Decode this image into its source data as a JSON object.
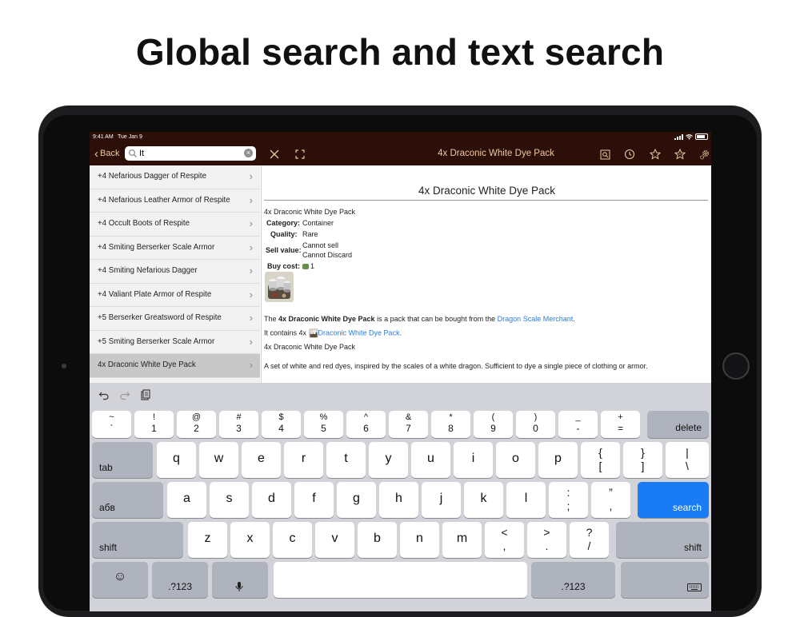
{
  "headline": "Global search and text search",
  "status": {
    "time": "9:41 AM",
    "date": "Tue Jan 9"
  },
  "left_nav": {
    "back_label": "Back",
    "search_value": "It"
  },
  "right_nav": {
    "title": "4x Draconic White Dye Pack"
  },
  "list_items": [
    "+4 Nefarious Dagger of Respite",
    "+4 Nefarious Leather Armor of Respite",
    "+4 Occult Boots of Respite",
    "+4 Smiting Berserker Scale Armor",
    "+4 Smiting Nefarious Dagger",
    "+4 Valiant Plate Armor of Respite",
    "+5 Berserker Greatsword of Respite",
    "+5 Smiting Berserker Scale Armor",
    "4x Draconic White Dye Pack"
  ],
  "detail": {
    "heading": "4x Draconic White Dye Pack",
    "name_line": "4x Draconic White Dye Pack",
    "category_label": "Category:",
    "category_value": "Container",
    "quality_label": "Quality:",
    "quality_value": "Rare",
    "sell_label": "Sell value:",
    "sell_value_1": "Cannot sell",
    "sell_value_2": "Cannot Discard",
    "buy_label": "Buy cost:",
    "buy_value": "1",
    "desc1_a": "The ",
    "desc1_bold": "4x Draconic White Dye Pack",
    "desc1_b": " is a pack that can be bought from the ",
    "desc1_link": "Dragon Scale Merchant",
    "desc1_c": ".",
    "desc2_a": "It contains 4x ",
    "desc2_link": "Draconic White Dye Pack",
    "desc2_c": ".",
    "desc3": "4x Draconic White Dye Pack",
    "desc4": "A set of white and red dyes, inspired by the scales of a white dragon. Sufficient to dye a single piece of clothing or armor."
  },
  "keyboard": {
    "row1": [
      {
        "top": "~",
        "bot": "`"
      },
      {
        "top": "!",
        "bot": "1"
      },
      {
        "top": "@",
        "bot": "2"
      },
      {
        "top": "#",
        "bot": "3"
      },
      {
        "top": "$",
        "bot": "4"
      },
      {
        "top": "%",
        "bot": "5"
      },
      {
        "top": "^",
        "bot": "6"
      },
      {
        "top": "&",
        "bot": "7"
      },
      {
        "top": "*",
        "bot": "8"
      },
      {
        "top": "(",
        "bot": "9"
      },
      {
        "top": ")",
        "bot": "0"
      },
      {
        "top": "_",
        "bot": "-"
      },
      {
        "top": "+",
        "bot": "="
      }
    ],
    "delete": "delete",
    "tab": "tab",
    "row2": [
      "q",
      "w",
      "e",
      "r",
      "t",
      "y",
      "u",
      "i",
      "o",
      "p"
    ],
    "row2_extra": [
      {
        "top": "{",
        "bot": "["
      },
      {
        "top": "}",
        "bot": "]"
      },
      {
        "top": "|",
        "bot": "\\"
      }
    ],
    "lang": "абв",
    "row3": [
      "a",
      "s",
      "d",
      "f",
      "g",
      "h",
      "j",
      "k",
      "l"
    ],
    "row3_extra": [
      {
        "top": ":",
        "bot": ";"
      },
      {
        "top": "”",
        "bot": ","
      }
    ],
    "search": "search",
    "shift": "shift",
    "row4": [
      "z",
      "x",
      "c",
      "v",
      "b",
      "n",
      "m"
    ],
    "row4_extra": [
      {
        "top": "<",
        "bot": ","
      },
      {
        "top": ">",
        "bot": "."
      },
      {
        "top": "?",
        "bot": "/"
      }
    ],
    "numkey": ".?123",
    "emoji": "☺"
  },
  "colors": {
    "nav_bg": "#2b0f08",
    "nav_text": "#f0c8a0",
    "link": "#2f7bd6",
    "search_key": "#1a7cf5"
  }
}
